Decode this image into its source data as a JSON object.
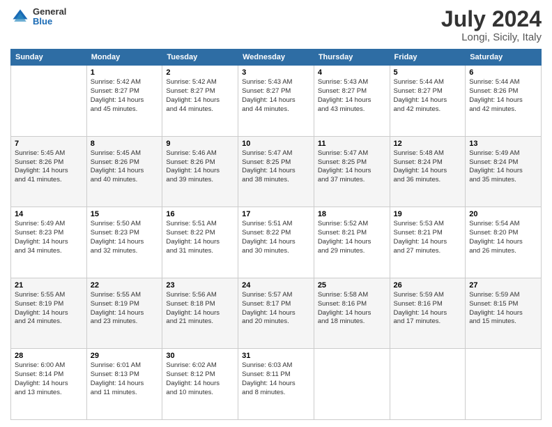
{
  "header": {
    "logo_general": "General",
    "logo_blue": "Blue",
    "month_year": "July 2024",
    "location": "Longi, Sicily, Italy"
  },
  "weekdays": [
    "Sunday",
    "Monday",
    "Tuesday",
    "Wednesday",
    "Thursday",
    "Friday",
    "Saturday"
  ],
  "weeks": [
    [
      {
        "day": "",
        "info": ""
      },
      {
        "day": "1",
        "info": "Sunrise: 5:42 AM\nSunset: 8:27 PM\nDaylight: 14 hours\nand 45 minutes."
      },
      {
        "day": "2",
        "info": "Sunrise: 5:42 AM\nSunset: 8:27 PM\nDaylight: 14 hours\nand 44 minutes."
      },
      {
        "day": "3",
        "info": "Sunrise: 5:43 AM\nSunset: 8:27 PM\nDaylight: 14 hours\nand 44 minutes."
      },
      {
        "day": "4",
        "info": "Sunrise: 5:43 AM\nSunset: 8:27 PM\nDaylight: 14 hours\nand 43 minutes."
      },
      {
        "day": "5",
        "info": "Sunrise: 5:44 AM\nSunset: 8:27 PM\nDaylight: 14 hours\nand 42 minutes."
      },
      {
        "day": "6",
        "info": "Sunrise: 5:44 AM\nSunset: 8:26 PM\nDaylight: 14 hours\nand 42 minutes."
      }
    ],
    [
      {
        "day": "7",
        "info": "Sunrise: 5:45 AM\nSunset: 8:26 PM\nDaylight: 14 hours\nand 41 minutes."
      },
      {
        "day": "8",
        "info": "Sunrise: 5:45 AM\nSunset: 8:26 PM\nDaylight: 14 hours\nand 40 minutes."
      },
      {
        "day": "9",
        "info": "Sunrise: 5:46 AM\nSunset: 8:26 PM\nDaylight: 14 hours\nand 39 minutes."
      },
      {
        "day": "10",
        "info": "Sunrise: 5:47 AM\nSunset: 8:25 PM\nDaylight: 14 hours\nand 38 minutes."
      },
      {
        "day": "11",
        "info": "Sunrise: 5:47 AM\nSunset: 8:25 PM\nDaylight: 14 hours\nand 37 minutes."
      },
      {
        "day": "12",
        "info": "Sunrise: 5:48 AM\nSunset: 8:24 PM\nDaylight: 14 hours\nand 36 minutes."
      },
      {
        "day": "13",
        "info": "Sunrise: 5:49 AM\nSunset: 8:24 PM\nDaylight: 14 hours\nand 35 minutes."
      }
    ],
    [
      {
        "day": "14",
        "info": "Sunrise: 5:49 AM\nSunset: 8:23 PM\nDaylight: 14 hours\nand 34 minutes."
      },
      {
        "day": "15",
        "info": "Sunrise: 5:50 AM\nSunset: 8:23 PM\nDaylight: 14 hours\nand 32 minutes."
      },
      {
        "day": "16",
        "info": "Sunrise: 5:51 AM\nSunset: 8:22 PM\nDaylight: 14 hours\nand 31 minutes."
      },
      {
        "day": "17",
        "info": "Sunrise: 5:51 AM\nSunset: 8:22 PM\nDaylight: 14 hours\nand 30 minutes."
      },
      {
        "day": "18",
        "info": "Sunrise: 5:52 AM\nSunset: 8:21 PM\nDaylight: 14 hours\nand 29 minutes."
      },
      {
        "day": "19",
        "info": "Sunrise: 5:53 AM\nSunset: 8:21 PM\nDaylight: 14 hours\nand 27 minutes."
      },
      {
        "day": "20",
        "info": "Sunrise: 5:54 AM\nSunset: 8:20 PM\nDaylight: 14 hours\nand 26 minutes."
      }
    ],
    [
      {
        "day": "21",
        "info": "Sunrise: 5:55 AM\nSunset: 8:19 PM\nDaylight: 14 hours\nand 24 minutes."
      },
      {
        "day": "22",
        "info": "Sunrise: 5:55 AM\nSunset: 8:19 PM\nDaylight: 14 hours\nand 23 minutes."
      },
      {
        "day": "23",
        "info": "Sunrise: 5:56 AM\nSunset: 8:18 PM\nDaylight: 14 hours\nand 21 minutes."
      },
      {
        "day": "24",
        "info": "Sunrise: 5:57 AM\nSunset: 8:17 PM\nDaylight: 14 hours\nand 20 minutes."
      },
      {
        "day": "25",
        "info": "Sunrise: 5:58 AM\nSunset: 8:16 PM\nDaylight: 14 hours\nand 18 minutes."
      },
      {
        "day": "26",
        "info": "Sunrise: 5:59 AM\nSunset: 8:16 PM\nDaylight: 14 hours\nand 17 minutes."
      },
      {
        "day": "27",
        "info": "Sunrise: 5:59 AM\nSunset: 8:15 PM\nDaylight: 14 hours\nand 15 minutes."
      }
    ],
    [
      {
        "day": "28",
        "info": "Sunrise: 6:00 AM\nSunset: 8:14 PM\nDaylight: 14 hours\nand 13 minutes."
      },
      {
        "day": "29",
        "info": "Sunrise: 6:01 AM\nSunset: 8:13 PM\nDaylight: 14 hours\nand 11 minutes."
      },
      {
        "day": "30",
        "info": "Sunrise: 6:02 AM\nSunset: 8:12 PM\nDaylight: 14 hours\nand 10 minutes."
      },
      {
        "day": "31",
        "info": "Sunrise: 6:03 AM\nSunset: 8:11 PM\nDaylight: 14 hours\nand 8 minutes."
      },
      {
        "day": "",
        "info": ""
      },
      {
        "day": "",
        "info": ""
      },
      {
        "day": "",
        "info": ""
      }
    ]
  ]
}
